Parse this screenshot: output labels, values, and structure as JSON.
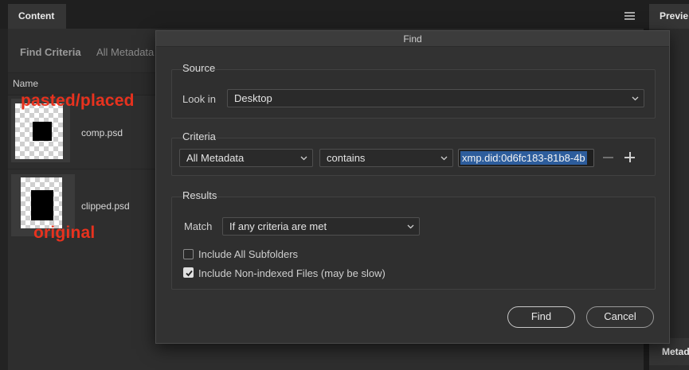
{
  "app": {
    "tabs": {
      "content": "Content",
      "preview": "Previe",
      "metadata": "Metad"
    },
    "filter_bar": {
      "find_criteria": "Find Criteria",
      "all_metadata": "All Metadata"
    },
    "list": {
      "name_header": "Name",
      "files": [
        {
          "name": "comp.psd",
          "annotation": "pasted/placed"
        },
        {
          "name": "clipped.psd",
          "annotation": "original"
        }
      ]
    }
  },
  "dialog": {
    "title": "Find",
    "source": {
      "label": "Source",
      "look_in_label": "Look in",
      "look_in_value": "Desktop"
    },
    "criteria": {
      "label": "Criteria",
      "field": "All Metadata",
      "operator": "contains",
      "value": "xmp.did:0d6fc183-81b8-4b"
    },
    "results": {
      "label": "Results",
      "match_label": "Match",
      "match_value": "If any criteria are met",
      "include_subfolders": {
        "label": "Include All Subfolders",
        "checked": false
      },
      "include_nonindexed": {
        "label": "Include Non-indexed Files (may be slow)",
        "checked": true
      }
    },
    "buttons": {
      "find": "Find",
      "cancel": "Cancel"
    }
  },
  "colors": {
    "annotation": "#e8321e",
    "selection": "#2d5d9c"
  }
}
